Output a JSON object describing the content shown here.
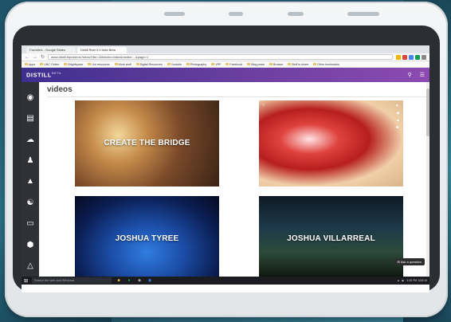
{
  "browser": {
    "tabs": [
      "Favorites - Google Slides",
      "Distill Reel 2.0 beta Beta"
    ],
    "url": "www.distill.tt/p/videos?showTitle=1&hidden=false&media=...&page=1",
    "bookmarks": [
      "Apps",
      "UNC Online",
      "Brightspace",
      "Uni resources",
      "Work stuff",
      "Digital Resources",
      "Youtube",
      "Photography",
      "VRF",
      "Facebook",
      "Blog posts",
      "Browse",
      "Stuff to share",
      "Other bookmarks"
    ]
  },
  "app": {
    "logo": "DISTILL",
    "logo_badge": "BETA",
    "page_title": "videos",
    "sidebar_icons": [
      "drop-icon",
      "book-icon",
      "cloud-icon",
      "person-icon",
      "building-icon",
      "hands-icon",
      "laptop-icon",
      "hexagon-icon",
      "triangle-icon"
    ],
    "cards": [
      {
        "title": "CREATE THE BRIDGE"
      },
      {
        "title": ""
      },
      {
        "title": "JOSHUA TYREE"
      },
      {
        "title": "JOSHUA VILLARREAL"
      }
    ],
    "ask_question": "Ask a question"
  },
  "taskbar": {
    "search_placeholder": "Search the web and Windows",
    "time": "3:45 PM",
    "date": "10/6/15"
  },
  "colors": {
    "header_gradient_start": "#3e2f8f",
    "header_gradient_end": "#8c4bb0",
    "sidebar": "#2f3136"
  }
}
